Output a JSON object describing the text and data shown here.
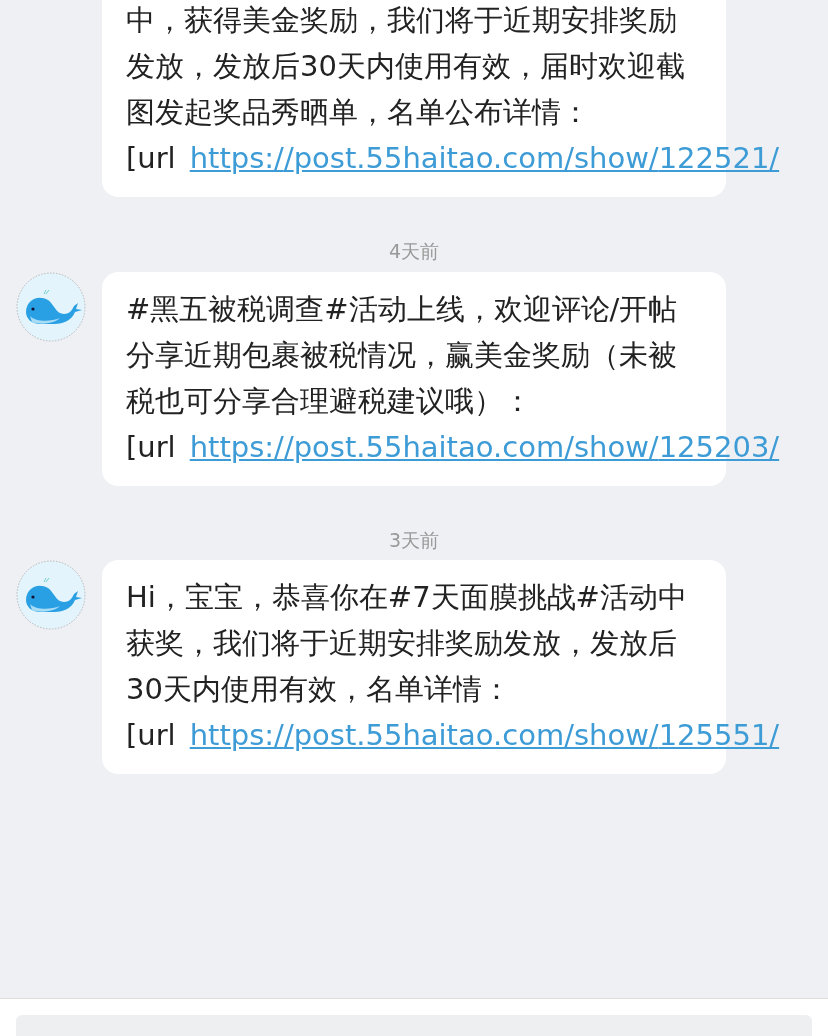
{
  "messages": [
    {
      "kind": "continued",
      "text": "中，获得美金奖励，我们将于近期安排奖励发放，发放后30天内使用有效，届时欢迎截图发起奖品秀晒单，名单公布详情：[url",
      "link": "https://post.55haitao.com/show/122521/"
    },
    {
      "kind": "full",
      "time": "4天前",
      "text": "#黑五被税调查#活动上线，欢迎评论/开帖分享近期包裹被税情况，赢美金奖励（未被税也可分享合理避税建议哦）：[url",
      "link": "https://post.55haitao.com/show/125203/"
    },
    {
      "kind": "full",
      "time": "3天前",
      "text": "Hi，宝宝，恭喜你在#7天面膜挑战#活动中获奖，我们将于近期安排奖励发放，发放后30天内使用有效，名单详情：[url",
      "link": "https://post.55haitao.com/show/125551/"
    }
  ]
}
